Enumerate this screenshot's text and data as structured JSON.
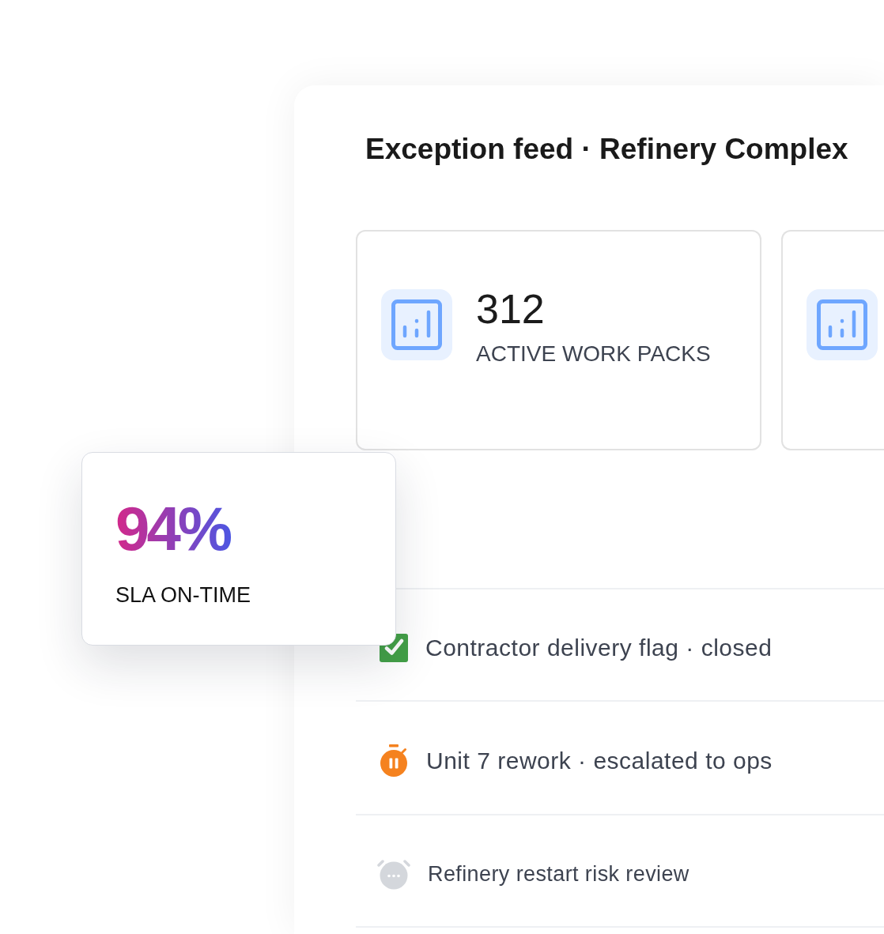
{
  "panel": {
    "title": "Exception feed · Refinery Complex"
  },
  "stats": [
    {
      "value": "312",
      "label": "ACTIVE WORK PACKS",
      "clipped": false
    },
    {
      "clipped": true
    }
  ],
  "highlight": {
    "value": "94%",
    "label": "SLA ON-TIME"
  },
  "feed": [
    {
      "kind": "done",
      "text": "Contractor delivery flag · closed"
    },
    {
      "kind": "escalated",
      "text": "Unit 7 rework · escalated to ops"
    },
    {
      "kind": "pending",
      "text": "Refinery restart risk review"
    }
  ]
}
